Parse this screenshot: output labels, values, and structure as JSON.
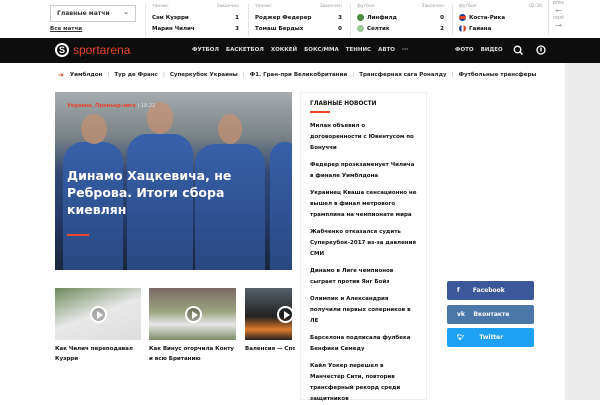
{
  "scores": {
    "dropdown": "Главные матчи",
    "all_matches": "Все матчи",
    "matches": [
      {
        "sport": "теннис",
        "status": "Закончен",
        "teams": [
          {
            "name": "Сэм Куэрри",
            "score": "1"
          },
          {
            "name": "Марин Чилич",
            "score": "3"
          }
        ]
      },
      {
        "sport": "теннис",
        "status": "Закончен",
        "teams": [
          {
            "name": "Роджер Федерер",
            "score": "3"
          },
          {
            "name": "Томаш Бердых",
            "score": "0"
          }
        ]
      },
      {
        "sport": "футбол",
        "status": "Закончен",
        "teams": [
          {
            "name": "Линфилд",
            "score": "0"
          },
          {
            "name": "Селтик",
            "score": "2"
          }
        ]
      },
      {
        "sport": "футбол",
        "status": "02:30",
        "teams": [
          {
            "name": "Коста-Рика",
            "score": ""
          },
          {
            "name": "Гаиана",
            "score": ""
          }
        ]
      }
    ],
    "prev": "prev",
    "next": "next"
  },
  "nav": {
    "logo": "sportarena",
    "items": [
      "ФУТБОЛ",
      "БАСКЕТБОЛ",
      "ХОККЕЙ",
      "БОКС/ММА",
      "ТЕННИС",
      "АВТО",
      "···"
    ],
    "right": [
      "ФОТО",
      "ВИДЕО"
    ]
  },
  "trending": [
    "Уимблдон",
    "Тур де Франс",
    "Суперкубок Украины",
    "Ф1. Гран-при Великобритании",
    "Трансферная сага Роналду",
    "Футбольные трансферы"
  ],
  "hero": {
    "tag": "Украина. Премьер-лига",
    "time": "18:22",
    "title": "Динамо Хацкевича, не Реброва. Итоги сбора киевлян"
  },
  "videos": [
    {
      "caption": "Как Чилич переподавал Куэрри"
    },
    {
      "caption": "Как Винус огорчила Конту и всю Британию"
    },
    {
      "caption": "Валенсия — Спо"
    }
  ],
  "news": {
    "title": "ГЛАВНЫЕ НОВОСТИ",
    "items": [
      "Милан объявил о договоренности с Ювентусом по Бонуччи",
      "Федерер проэкзаменует Чилича в финале Уимблдона",
      "Украинец Кваша сенсационно не вышел в финал метрового трамплина на чемпионате мира",
      "Жабченко отказался судить Суперкубок-2017 из-за давления СМИ",
      "Динамо в Лиге чемпионов сыграет против Янг Бойз",
      "Олимпик и Александрия получили первых соперников в ЛЕ",
      "Барселона подписала фулбека Бенфики Семеду",
      "Кайл Уокер перешел в Манчестер Сити, повторив трансферный рекорд среди защитников"
    ]
  },
  "social": [
    {
      "label": "Facebook",
      "icon": "f",
      "color": "#3b5998"
    },
    {
      "label": "Вконтакте",
      "icon": "vk",
      "color": "#4a76a8"
    },
    {
      "label": "Twitter",
      "icon": "t",
      "color": "#1da1f2"
    }
  ],
  "colors": {
    "accent": "#e8452c",
    "nav": "#0d0d0d"
  }
}
